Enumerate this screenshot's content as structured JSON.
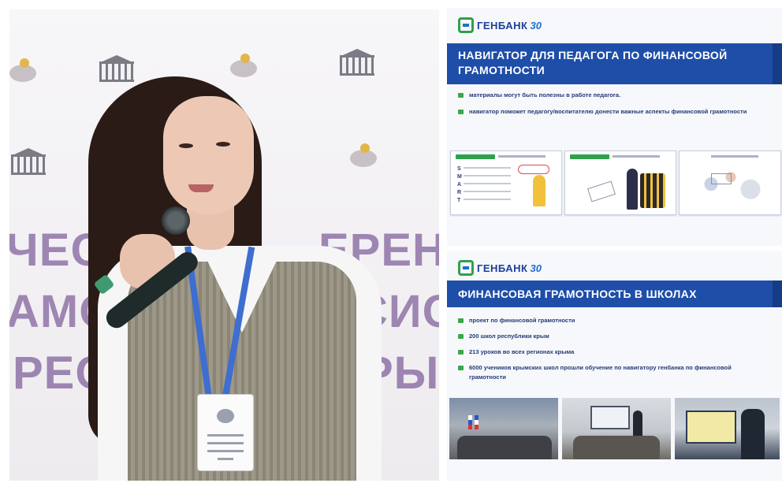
{
  "slide1": {
    "bank_name": "ГЕНБАНК",
    "bank_anniversary": "30",
    "title": "НАВИГАТОР ДЛЯ ПЕДАГОГА ПО ФИНАНСОВОЙ ГРАМОТНОСТИ",
    "bullets": [
      "материалы могут быть полезны в работе педагога.",
      "навигатор поможет педагогу/воспитателю донести важные аспекты финансовой грамотности"
    ],
    "thumb1_letters": "S M A R T"
  },
  "slide2": {
    "bank_name": "ГЕНБАНК",
    "bank_anniversary": "30",
    "title": "ФИНАНСОВАЯ ГРАМОТНОСТЬ В ШКОЛАХ",
    "bullets": [
      "проект по финансовой грамотности",
      "200 школ республики крым",
      "213 уроков во всех регионах крыма",
      "6000 учеников крымских школ прошли обучение по навигатору генбанка по финансовой грамотности"
    ]
  },
  "colors": {
    "title_bar": "#1e4ea8",
    "bullet_marker": "#3aa84a",
    "text": "#253b78"
  }
}
